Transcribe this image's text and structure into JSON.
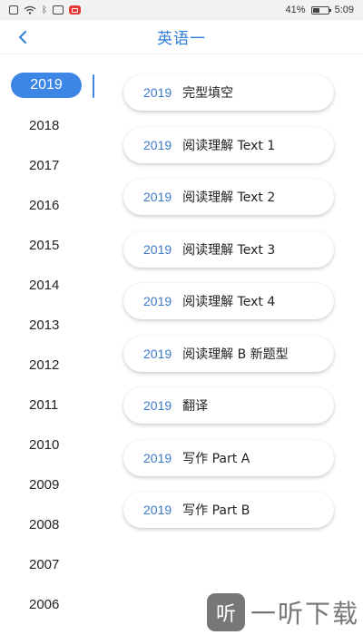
{
  "status_bar": {
    "battery": "41%",
    "time": "5:09"
  },
  "header": {
    "title": "英语一"
  },
  "years": [
    "2019",
    "2018",
    "2017",
    "2016",
    "2015",
    "2014",
    "2013",
    "2012",
    "2011",
    "2010",
    "2009",
    "2008",
    "2007",
    "2006"
  ],
  "selected_year": "2019",
  "topics": [
    {
      "year": "2019",
      "name": "完型填空"
    },
    {
      "year": "2019",
      "name": "阅读理解 Text 1"
    },
    {
      "year": "2019",
      "name": "阅读理解 Text 2"
    },
    {
      "year": "2019",
      "name": "阅读理解 Text 3"
    },
    {
      "year": "2019",
      "name": "阅读理解 Text 4"
    },
    {
      "year": "2019",
      "name": "阅读理解 B 新题型"
    },
    {
      "year": "2019",
      "name": "翻译"
    },
    {
      "year": "2019",
      "name": "写作 Part A"
    },
    {
      "year": "2019",
      "name": "写作 Part B"
    }
  ],
  "watermark": {
    "logo_text": "听",
    "text": "一听下载"
  },
  "colors": {
    "accent": "#3d86e6",
    "title": "#2f7fd6"
  }
}
